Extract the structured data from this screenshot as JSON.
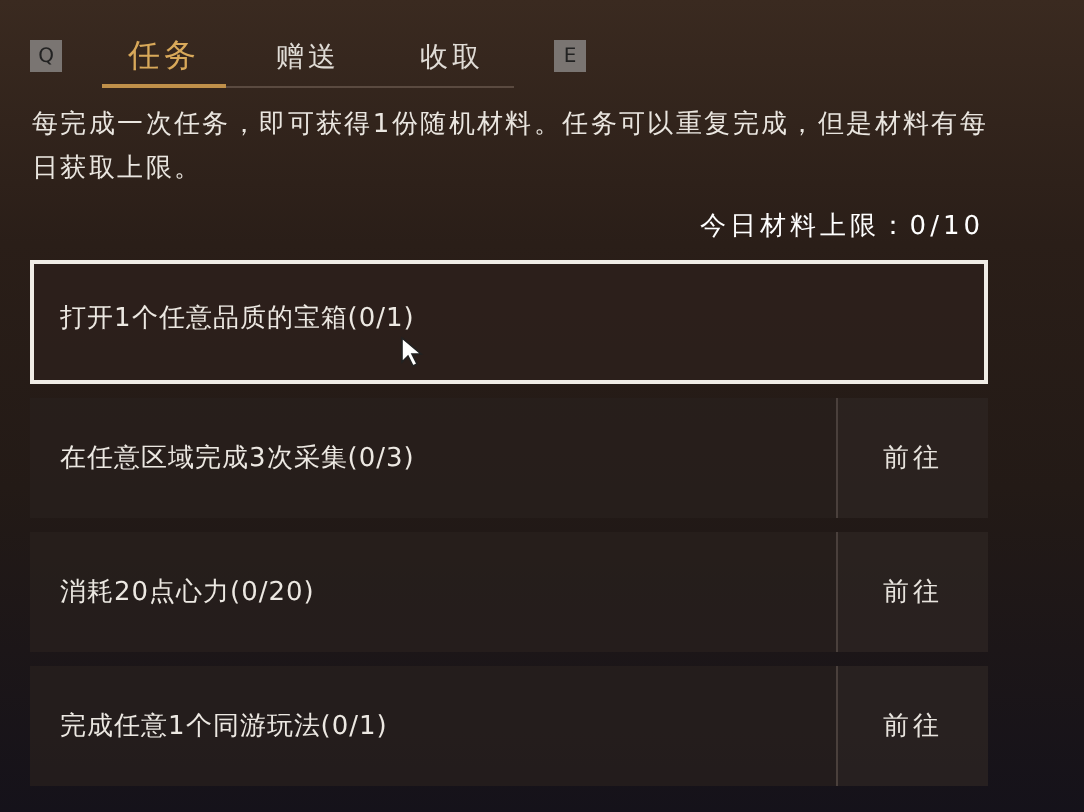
{
  "tabs": {
    "prev_key": "Q",
    "next_key": "E",
    "items": [
      {
        "label": "任务",
        "selected": true
      },
      {
        "label": "赠送",
        "selected": false
      },
      {
        "label": "收取",
        "selected": false
      }
    ]
  },
  "description": "每完成一次任务，即可获得1份随机材料。任务可以重复完成，但是材料有每日获取上限。",
  "daily_limit": "今日材料上限：0/10",
  "tasks": [
    {
      "text": "打开1个任意品质的宝箱(0/1)",
      "selected": true
    },
    {
      "text": "在任意区域完成3次采集(0/3)",
      "selected": false,
      "action": "前往"
    },
    {
      "text": "消耗20点心力(0/20)",
      "selected": false,
      "action": "前往"
    },
    {
      "text": "完成任意1个同游玩法(0/1)",
      "selected": false,
      "action": "前往"
    }
  ]
}
